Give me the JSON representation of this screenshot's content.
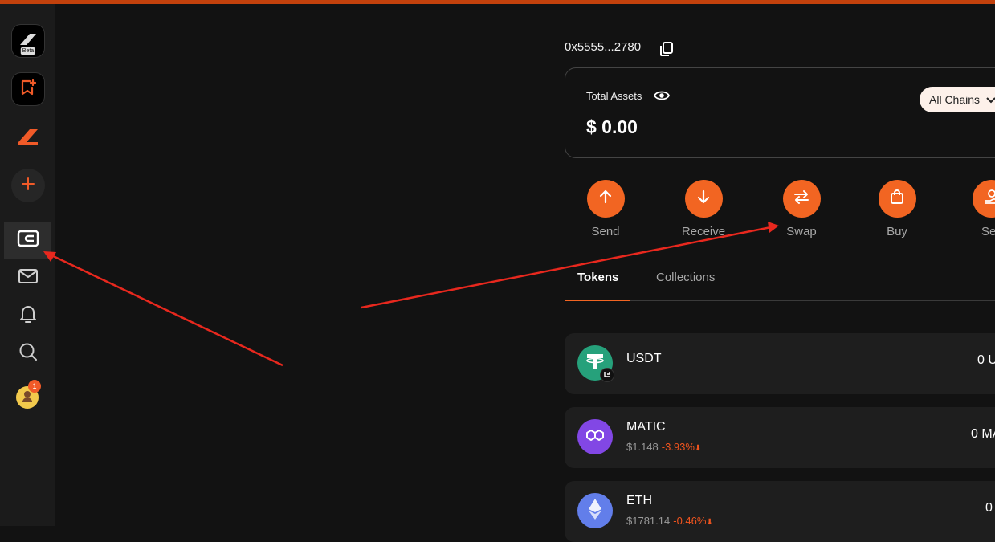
{
  "wallet": {
    "address": "0x5555...2780"
  },
  "sidebar": {
    "beta_label": "Beta",
    "notification_count": "1"
  },
  "assets": {
    "label": "Total Assets",
    "value": "$ 0.00",
    "chains_label": "All Chains"
  },
  "actions": [
    {
      "label": "Send",
      "icon": "arrow-up-icon"
    },
    {
      "label": "Receive",
      "icon": "arrow-down-icon"
    },
    {
      "label": "Swap",
      "icon": "swap-icon"
    },
    {
      "label": "Buy",
      "icon": "bag-icon"
    },
    {
      "label": "Se",
      "icon": "sell-icon"
    }
  ],
  "tabs": [
    {
      "label": "Tokens",
      "active": true
    },
    {
      "label": "Collections",
      "active": false
    }
  ],
  "tokens": [
    {
      "name": "USDT",
      "price": "",
      "change": "",
      "amount": "0 U",
      "color": "#26a17b"
    },
    {
      "name": "MATIC",
      "price": "$1.148",
      "change": "-3.93%",
      "amount": "0 MA",
      "color": "#8247e5"
    },
    {
      "name": "ETH",
      "price": "$1781.14",
      "change": "-0.46%",
      "amount": "0",
      "color": "#627eea"
    }
  ],
  "colors": {
    "accent": "#f26522",
    "negative": "#f0541e",
    "annotation_arrow": "#e8281e"
  }
}
